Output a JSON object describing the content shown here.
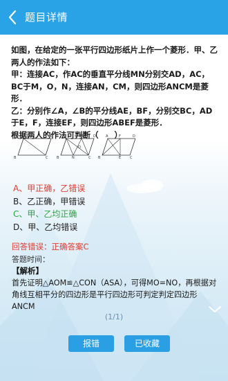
{
  "header": {
    "title": "题目详情"
  },
  "question": {
    "text": "如图，在给定的一张平行四边形纸片上作一个菱形．甲、乙两人的作法如下：\n甲：连接AC，作AC的垂直平分线MN分别交AD，AC，BC于M，O，N，连接AN，CM，则四边形ANCM是菱形．\n乙：分别作∠A，∠B的平分线AE，BF，分别交BC，AD于E，F，连接EF，则四边形ABEF是菱形．\n根据两人的作法可判断（　　）"
  },
  "figure": {
    "labels": [
      "A",
      "D",
      "B",
      "C",
      "A",
      "M",
      "D",
      "O",
      "B",
      "N",
      "C",
      "A",
      "F",
      "D",
      "B",
      "E",
      "C"
    ]
  },
  "options": [
    {
      "label": "A、甲正确，乙错误",
      "state": "wrong"
    },
    {
      "label": "B、乙正确，甲错误",
      "state": "normal"
    },
    {
      "label": "C、甲、乙均正确",
      "state": "correct"
    },
    {
      "label": "D、甲、乙均错误",
      "state": "normal"
    }
  ],
  "result": {
    "text": "回答错误：正确答案C"
  },
  "time": {
    "label": "答题时间："
  },
  "analysis": {
    "title": "【解析】",
    "text": "首先证明△AOM≌△CON（ASA），可得MO=NO，再根据对角线互相平分的四边形是平行四边形可判定判定四边形ANCM"
  },
  "pagination": {
    "text": "(1/1)"
  },
  "buttons": {
    "report": "报错",
    "favorite": "已收藏"
  },
  "colors": {
    "header": "#29a3e6",
    "wrong": "#e23a2f",
    "correct": "#27a640",
    "button": "#2b9fe4"
  },
  "icons": {
    "back": "chevron-left-icon",
    "expand": "chevron-down-icon"
  }
}
